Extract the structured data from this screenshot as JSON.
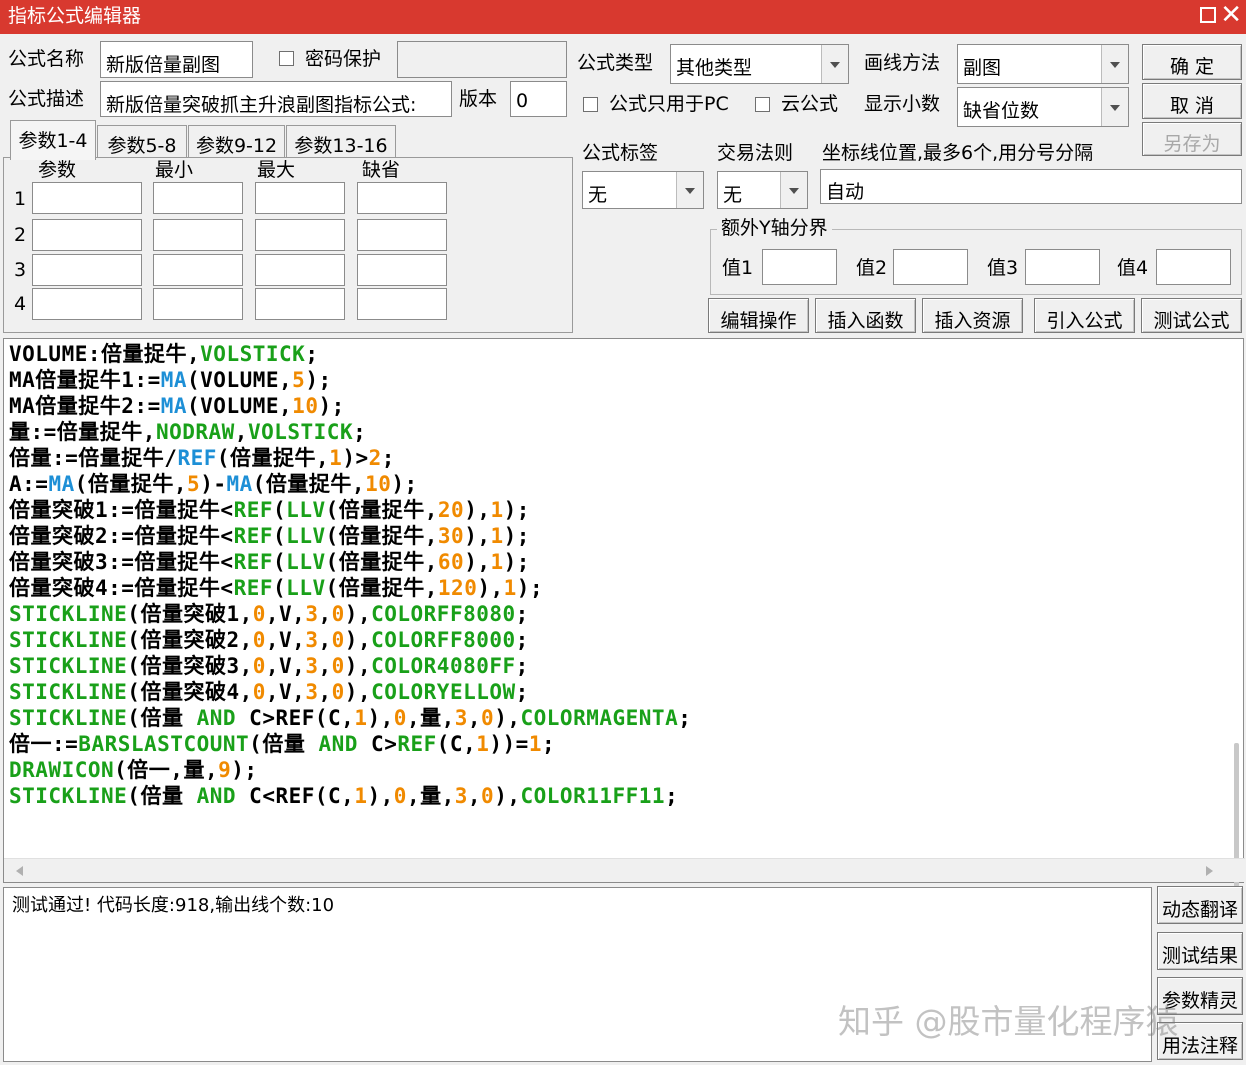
{
  "window": {
    "title": "指标公式编辑器"
  },
  "labels": {
    "formula_name": "公式名称",
    "password": "密码保护",
    "formula_type": "公式类型",
    "draw_method": "画线方法",
    "formula_desc": "公式描述",
    "version": "版本",
    "pc_only": "公式只用于PC",
    "cloud": "云公式",
    "decimals": "显示小数",
    "formula_tag": "公式标签",
    "trade_rule": "交易法则",
    "axis_pos": "坐标线位置,最多6个,用分号分隔",
    "extra_y": "额外Y轴分界",
    "v1": "值1",
    "v2": "值2",
    "v3": "值3",
    "v4": "值4"
  },
  "values": {
    "formula_name": "新版倍量副图",
    "formula_desc": "新版倍量突破抓主升浪副图指标公式:",
    "version": "0",
    "formula_type": "其他类型",
    "draw_method": "副图",
    "decimals": "缺省位数",
    "formula_tag": "无",
    "trade_rule": "无",
    "axis_pos": "自动"
  },
  "buttons": {
    "ok": "确  定",
    "cancel": "取  消",
    "save_as": "另存为",
    "edit_ops": "编辑操作",
    "insert_func": "插入函数",
    "insert_res": "插入资源",
    "import_formula": "引入公式",
    "test_formula": "测试公式",
    "dyn_translate": "动态翻译",
    "test_result": "测试结果",
    "param_wizard": "参数精灵",
    "usage_notes": "用法注释"
  },
  "tabs": [
    "参数1-4",
    "参数5-8",
    "参数9-12",
    "参数13-16"
  ],
  "param_headers": [
    "参数",
    "最小",
    "最大",
    "缺省"
  ],
  "param_rows": [
    "1",
    "2",
    "3",
    "4"
  ],
  "code_lines": [
    [
      [
        "p",
        "VOLUME:倍量捉牛,"
      ],
      [
        "k",
        "VOLSTICK"
      ],
      [
        "p",
        ";"
      ]
    ],
    [
      [
        "p",
        "MA倍量捉牛1:="
      ],
      [
        "f",
        "MA"
      ],
      [
        "p",
        "(VOLUME,"
      ],
      [
        "n",
        "5"
      ],
      [
        "p",
        ");"
      ]
    ],
    [
      [
        "p",
        "MA倍量捉牛2:="
      ],
      [
        "f",
        "MA"
      ],
      [
        "p",
        "(VOLUME,"
      ],
      [
        "n",
        "10"
      ],
      [
        "p",
        ");"
      ]
    ],
    [
      [
        "p",
        "量:=倍量捉牛,"
      ],
      [
        "k",
        "NODRAW"
      ],
      [
        "p",
        ","
      ],
      [
        "k",
        "VOLSTICK"
      ],
      [
        "p",
        ";"
      ]
    ],
    [
      [
        "p",
        "倍量:=倍量捉牛/"
      ],
      [
        "f",
        "REF"
      ],
      [
        "p",
        "(倍量捉牛,"
      ],
      [
        "n",
        "1"
      ],
      [
        "p",
        ")>"
      ],
      [
        "n",
        "2"
      ],
      [
        "p",
        ";"
      ]
    ],
    [
      [
        "p",
        "A:="
      ],
      [
        "f",
        "MA"
      ],
      [
        "p",
        "(倍量捉牛,"
      ],
      [
        "n",
        "5"
      ],
      [
        "p",
        ")-"
      ],
      [
        "f",
        "MA"
      ],
      [
        "p",
        "(倍量捉牛,"
      ],
      [
        "n",
        "10"
      ],
      [
        "p",
        ");"
      ]
    ],
    [
      [
        "p",
        "倍量突破1:=倍量捉牛<"
      ],
      [
        "k",
        "REF"
      ],
      [
        "p",
        "("
      ],
      [
        "k",
        "LLV"
      ],
      [
        "p",
        "(倍量捉牛,"
      ],
      [
        "n",
        "20"
      ],
      [
        "p",
        "),"
      ],
      [
        "n",
        "1"
      ],
      [
        "p",
        ");"
      ]
    ],
    [
      [
        "p",
        "倍量突破2:=倍量捉牛<"
      ],
      [
        "k",
        "REF"
      ],
      [
        "p",
        "("
      ],
      [
        "k",
        "LLV"
      ],
      [
        "p",
        "(倍量捉牛,"
      ],
      [
        "n",
        "30"
      ],
      [
        "p",
        "),"
      ],
      [
        "n",
        "1"
      ],
      [
        "p",
        ");"
      ]
    ],
    [
      [
        "p",
        "倍量突破3:=倍量捉牛<"
      ],
      [
        "k",
        "REF"
      ],
      [
        "p",
        "("
      ],
      [
        "k",
        "LLV"
      ],
      [
        "p",
        "(倍量捉牛,"
      ],
      [
        "n",
        "60"
      ],
      [
        "p",
        "),"
      ],
      [
        "n",
        "1"
      ],
      [
        "p",
        ");"
      ]
    ],
    [
      [
        "p",
        "倍量突破4:=倍量捉牛<"
      ],
      [
        "k",
        "REF"
      ],
      [
        "p",
        "("
      ],
      [
        "k",
        "LLV"
      ],
      [
        "p",
        "(倍量捉牛,"
      ],
      [
        "n",
        "120"
      ],
      [
        "p",
        "),"
      ],
      [
        "n",
        "1"
      ],
      [
        "p",
        ");"
      ]
    ],
    [
      [
        "k",
        "STICKLINE"
      ],
      [
        "p",
        "(倍量突破1,"
      ],
      [
        "n",
        "0"
      ],
      [
        "p",
        ",V,"
      ],
      [
        "n",
        "3"
      ],
      [
        "p",
        ","
      ],
      [
        "n",
        "0"
      ],
      [
        "p",
        "),"
      ],
      [
        "k",
        "COLORFF8080"
      ],
      [
        "p",
        ";"
      ]
    ],
    [
      [
        "k",
        "STICKLINE"
      ],
      [
        "p",
        "(倍量突破2,"
      ],
      [
        "n",
        "0"
      ],
      [
        "p",
        ",V,"
      ],
      [
        "n",
        "3"
      ],
      [
        "p",
        ","
      ],
      [
        "n",
        "0"
      ],
      [
        "p",
        "),"
      ],
      [
        "k",
        "COLORFF8000"
      ],
      [
        "p",
        ";"
      ]
    ],
    [
      [
        "k",
        "STICKLINE"
      ],
      [
        "p",
        "(倍量突破3,"
      ],
      [
        "n",
        "0"
      ],
      [
        "p",
        ",V,"
      ],
      [
        "n",
        "3"
      ],
      [
        "p",
        ","
      ],
      [
        "n",
        "0"
      ],
      [
        "p",
        "),"
      ],
      [
        "k",
        "COLOR4080FF"
      ],
      [
        "p",
        ";"
      ]
    ],
    [
      [
        "k",
        "STICKLINE"
      ],
      [
        "p",
        "(倍量突破4,"
      ],
      [
        "n",
        "0"
      ],
      [
        "p",
        ",V,"
      ],
      [
        "n",
        "3"
      ],
      [
        "p",
        ","
      ],
      [
        "n",
        "0"
      ],
      [
        "p",
        "),"
      ],
      [
        "k",
        "COLORYELLOW"
      ],
      [
        "p",
        ";"
      ]
    ],
    [
      [
        "k",
        "STICKLINE"
      ],
      [
        "p",
        "(倍量 "
      ],
      [
        "k",
        "AND"
      ],
      [
        "p",
        " C>REF(C,"
      ],
      [
        "n",
        "1"
      ],
      [
        "p",
        "),"
      ],
      [
        "n",
        "0"
      ],
      [
        "p",
        ",量,"
      ],
      [
        "n",
        "3"
      ],
      [
        "p",
        ","
      ],
      [
        "n",
        "0"
      ],
      [
        "p",
        "),"
      ],
      [
        "k",
        "COLORMAGENTA"
      ],
      [
        "p",
        ";"
      ]
    ],
    [
      [
        "p",
        "倍一:="
      ],
      [
        "k",
        "BARSLASTCOUNT"
      ],
      [
        "p",
        "(倍量 "
      ],
      [
        "k",
        "AND"
      ],
      [
        "p",
        " C>"
      ],
      [
        "k",
        "REF"
      ],
      [
        "p",
        "(C,"
      ],
      [
        "n",
        "1"
      ],
      [
        "p",
        "))="
      ],
      [
        "n",
        "1"
      ],
      [
        "p",
        ";"
      ]
    ],
    [
      [
        "k",
        "DRAWICON"
      ],
      [
        "p",
        "(倍一,量,"
      ],
      [
        "n",
        "9"
      ],
      [
        "p",
        ");"
      ]
    ],
    [
      [
        "k",
        "STICKLINE"
      ],
      [
        "p",
        "(倍量 "
      ],
      [
        "k",
        "AND"
      ],
      [
        "p",
        " C<REF(C,"
      ],
      [
        "n",
        "1"
      ],
      [
        "p",
        "),"
      ],
      [
        "n",
        "0"
      ],
      [
        "p",
        ",量,"
      ],
      [
        "n",
        "3"
      ],
      [
        "p",
        ","
      ],
      [
        "n",
        "0"
      ],
      [
        "p",
        "),"
      ],
      [
        "k",
        "COLOR11FF11"
      ],
      [
        "p",
        ";"
      ]
    ]
  ],
  "output": {
    "text": "测试通过! 代码长度:918,输出线个数:10"
  },
  "watermark": "知乎 @股市量化程序猿",
  "colors": {
    "titlebar": "#d8392f",
    "keyword": "#19a019",
    "function": "#1d8fd6",
    "number": "#f08a00"
  }
}
